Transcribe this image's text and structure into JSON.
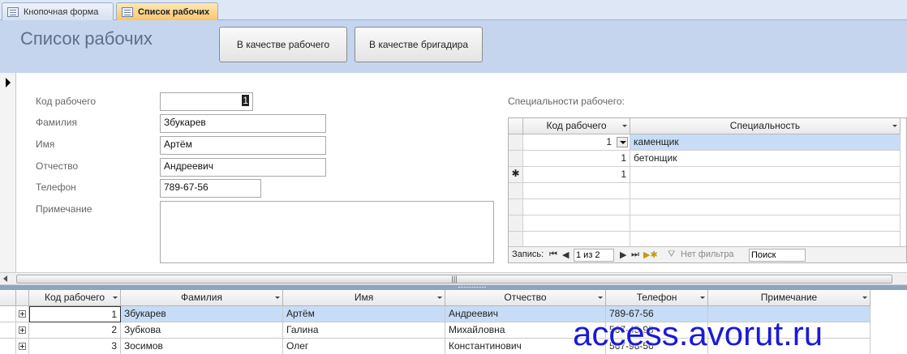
{
  "tabs": [
    {
      "label": "Кнопочная форма",
      "active": false
    },
    {
      "label": "Список рабочих",
      "active": true
    }
  ],
  "header": {
    "title": "Список рабочих",
    "btn_worker": "В качестве рабочего",
    "btn_brigadier": "В качестве бригадира"
  },
  "form": {
    "labels": {
      "code": "Код рабочего",
      "surname": "Фамилия",
      "name": "Имя",
      "patronymic": "Отчество",
      "phone": "Телефон",
      "note": "Примечание"
    },
    "values": {
      "code": "1",
      "surname": "Збукарев",
      "name": "Артём",
      "patronymic": "Андреевич",
      "phone": "789-67-56",
      "note": ""
    }
  },
  "subform": {
    "label": "Специальности рабочего:",
    "columns": {
      "code": "Код рабочего",
      "spec": "Специальность"
    },
    "rows": [
      {
        "code": "1",
        "spec": "каменщик"
      },
      {
        "code": "1",
        "spec": "бетонщик"
      },
      {
        "code": "1",
        "spec": ""
      }
    ],
    "new_row_marker": "✱",
    "nav": {
      "record_label": "Запись:",
      "position": "1 из 2",
      "filter": "Нет фильтра",
      "search": "Поиск"
    }
  },
  "scrollbar": {
    "grip": "|||"
  },
  "datasheet": {
    "columns": {
      "code": "Код рабочего",
      "surname": "Фамилия",
      "name": "Имя",
      "patronymic": "Отчество",
      "phone": "Телефон",
      "note": "Примечание"
    },
    "rows": [
      {
        "code": "1",
        "surname": "Збукарев",
        "name": "Артём",
        "patronymic": "Андреевич",
        "phone": "789-67-56",
        "note": ""
      },
      {
        "code": "2",
        "surname": "Зубкова",
        "name": "Галина",
        "patronymic": "Михайловна",
        "phone": "567-45-98",
        "note": ""
      },
      {
        "code": "3",
        "surname": "Зосимов",
        "name": "Олег",
        "patronymic": "Константинович",
        "phone": "567-98-56",
        "note": ""
      }
    ]
  },
  "watermark": "access.avorut.ru"
}
